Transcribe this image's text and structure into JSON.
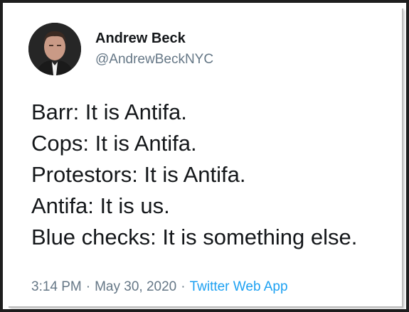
{
  "tweet": {
    "author": {
      "display_name": "Andrew Beck",
      "handle": "@AndrewBeckNYC"
    },
    "lines": [
      "Barr: It is Antifa.",
      "Cops: It is Antifa.",
      "Protestors: It is Antifa.",
      "Antifa: It is us.",
      "Blue checks: It is something else."
    ],
    "meta": {
      "time": "3:14 PM",
      "separator": "·",
      "date": "May 30, 2020",
      "source": "Twitter Web App"
    }
  },
  "colors": {
    "text": "#14171a",
    "secondary": "#657786",
    "link": "#1da1f2",
    "frame": "#1e1e1e"
  }
}
